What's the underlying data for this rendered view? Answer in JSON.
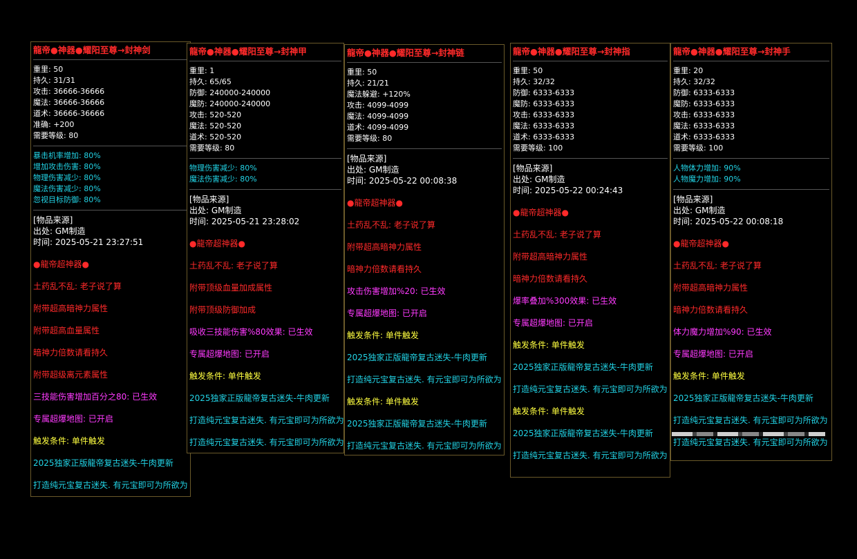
{
  "colors": {
    "white": "#ffffff",
    "red": "#ff2a2a",
    "magenta": "#ff3bff",
    "yellow": "#ffff40",
    "cyan": "#22d4e6",
    "border": "#6b5a2a"
  },
  "panels": [
    {
      "title": "龍帝●神器●耀阳至尊→封神剑",
      "stats": [
        "重里: 50",
        "持久: 31/31",
        "攻击: 36666-36666",
        "魔法: 36666-36666",
        "道术: 36666-36666",
        "准确: +200",
        "需要等级: 80"
      ],
      "bonuses": [
        "暴击机率增加: 80%",
        "增加攻击伤害: 80%",
        "物理伤害减少: 80%",
        "魔法伤害减少: 80%",
        "忽视目标防御: 80%"
      ],
      "source": [
        "[物品来源]",
        "出处: GM制造",
        "时间: 2025-05-21 23:27:51"
      ],
      "effects": [
        {
          "text": "●龍帝超神器●",
          "color": "red"
        },
        {
          "text": "土药乱不乱: 老子说了算",
          "color": "red"
        },
        {
          "text": "附带超高暗神力属性",
          "color": "red"
        },
        {
          "text": "附带超高血量属性",
          "color": "red"
        },
        {
          "text": "暗神力倍数请看持久",
          "color": "red"
        },
        {
          "text": "附带超级离元素属性",
          "color": "red"
        },
        {
          "text": "三技能伤害增加百分之80: 已生效",
          "color": "magenta"
        },
        {
          "text": "专属超爆地图: 已开启",
          "color": "magenta"
        },
        {
          "text": "触发条件: 单件触发",
          "color": "yellow"
        },
        {
          "text": "2025独家正版龍帝复古迷失-牛肉更新",
          "color": "cyan"
        },
        {
          "text": "打造纯元宝复古迷失. 有元宝即可为所欲为",
          "color": "cyan"
        }
      ]
    },
    {
      "title": "龍帝●神器●耀阳至尊→封神甲",
      "stats": [
        "重里: 1",
        "持久: 65/65",
        "防御: 240000-240000",
        "魔防: 240000-240000",
        "攻击: 520-520",
        "魔法: 520-520",
        "道术: 520-520",
        "需要等级: 80"
      ],
      "bonuses": [
        "物理伤害减少: 80%",
        "魔法伤害减少: 80%"
      ],
      "source": [
        "[物品来源]",
        "出处: GM制造",
        "时间: 2025-05-21 23:28:02"
      ],
      "effects": [
        {
          "text": "●龍帝超神器●",
          "color": "red"
        },
        {
          "text": "土药乱不乱: 老子说了算",
          "color": "red"
        },
        {
          "text": "附带顶级血量加成属性",
          "color": "red"
        },
        {
          "text": "附带顶级防御加成",
          "color": "red"
        },
        {
          "text": "吸收三技能伤害%80效果: 已生效",
          "color": "magenta"
        },
        {
          "text": "专属超爆地图: 已开启",
          "color": "magenta"
        },
        {
          "text": "触发条件: 单件触发",
          "color": "yellow"
        },
        {
          "text": "2025独家正版龍帝复古迷失-牛肉更新",
          "color": "cyan"
        },
        {
          "text": "打造纯元宝复古迷失. 有元宝即可为所欲为",
          "color": "cyan"
        },
        {
          "text": "打造纯元宝复古迷失. 有元宝即可为所欲为",
          "color": "cyan"
        }
      ]
    },
    {
      "title": "龍帝●神器●耀阳至尊→封神链",
      "stats": [
        "重里: 50",
        "持久: 21/21",
        "魔法躲避: +120%",
        "攻击: 4099-4099",
        "魔法: 4099-4099",
        "道术: 4099-4099",
        "需要等级: 80"
      ],
      "bonuses": [],
      "source": [
        "[物品来源]",
        "出处: GM制造",
        "时间: 2025-05-22 00:08:38"
      ],
      "effects": [
        {
          "text": "●龍帝超神器●",
          "color": "red"
        },
        {
          "text": "土药乱不乱: 老子说了算",
          "color": "red"
        },
        {
          "text": "附带超高暗神力属性",
          "color": "red"
        },
        {
          "text": "暗神力倍数请看持久",
          "color": "red"
        },
        {
          "text": "攻击伤害增加%20: 已生效",
          "color": "magenta"
        },
        {
          "text": "专属超爆地图: 已开启",
          "color": "magenta"
        },
        {
          "text": "触发条件: 单件触发",
          "color": "yellow"
        },
        {
          "text": "2025独家正版龍帝复古迷失-牛肉更新",
          "color": "cyan"
        },
        {
          "text": "打造纯元宝复古迷失. 有元宝即可为所欲为",
          "color": "cyan"
        },
        {
          "text": "触发条件: 单件触发",
          "color": "yellow"
        },
        {
          "text": "2025独家正版龍帝复古迷失-牛肉更新",
          "color": "cyan"
        },
        {
          "text": "打造纯元宝复古迷失. 有元宝即可为所欲为",
          "color": "cyan"
        }
      ]
    },
    {
      "title": "龍帝●神器●耀阳至尊→封神指",
      "stats": [
        "重里: 50",
        "持久: 32/32",
        "防御: 6333-6333",
        "魔防: 6333-6333",
        "攻击: 6333-6333",
        "魔法: 6333-6333",
        "道术: 6333-6333",
        "需要等级: 100"
      ],
      "bonuses": [],
      "source": [
        "[物品来源]",
        "出处: GM制造",
        "时间: 2025-05-22 00:24:43"
      ],
      "effects": [
        {
          "text": "●龍帝超神器●",
          "color": "red"
        },
        {
          "text": "土药乱不乱: 老子说了算",
          "color": "red"
        },
        {
          "text": "附带超高暗神力属性",
          "color": "red"
        },
        {
          "text": "暗神力倍数请看持久",
          "color": "red"
        },
        {
          "text": "爆率叠加%300效果: 已生效",
          "color": "magenta"
        },
        {
          "text": "专属超爆地图: 已开启",
          "color": "magenta"
        },
        {
          "text": "触发条件: 单件触发",
          "color": "yellow"
        },
        {
          "text": "2025独家正版龍帝复古迷失-牛肉更新",
          "color": "cyan"
        },
        {
          "text": "打造纯元宝复古迷失. 有元宝即可为所欲为",
          "color": "cyan"
        },
        {
          "text": "触发条件: 单件触发",
          "color": "yellow"
        },
        {
          "text": "2025独家正版龍帝复古迷失-牛肉更新",
          "color": "cyan"
        },
        {
          "text": "打造纯元宝复古迷失. 有元宝即可为所欲为",
          "color": "cyan"
        }
      ]
    },
    {
      "title": "龍帝●神器●耀阳至尊→封神手",
      "stats": [
        "重里: 20",
        "持久: 32/32",
        "防御: 6333-6333",
        "魔防: 6333-6333",
        "攻击: 6333-6333",
        "魔法: 6333-6333",
        "道术: 6333-6333",
        "需要等级: 100"
      ],
      "bonuses": [
        "人物体力增加: 90%",
        "人物魔力增加: 90%"
      ],
      "source": [
        "[物品来源]",
        "出处: GM制造",
        "时间: 2025-05-22 00:08:18"
      ],
      "effects": [
        {
          "text": "●龍帝超神器●",
          "color": "red"
        },
        {
          "text": "土药乱不乱: 老子说了算",
          "color": "red"
        },
        {
          "text": "附带超高暗神力属性",
          "color": "red"
        },
        {
          "text": "暗神力倍数请看持久",
          "color": "red"
        },
        {
          "text": "体力魔力增加%90: 已生效",
          "color": "magenta"
        },
        {
          "text": "专属超爆地图: 已开启",
          "color": "magenta"
        },
        {
          "text": "触发条件: 单件触发",
          "color": "yellow"
        },
        {
          "text": "2025独家正版龍帝复古迷失-牛肉更新",
          "color": "cyan"
        },
        {
          "text": "打造纯元宝复古迷失. 有元宝即可为所欲为",
          "color": "cyan"
        },
        {
          "text": "打造纯元宝复古迷失. 有元宝即可为所欲为",
          "color": "cyan"
        }
      ]
    }
  ]
}
